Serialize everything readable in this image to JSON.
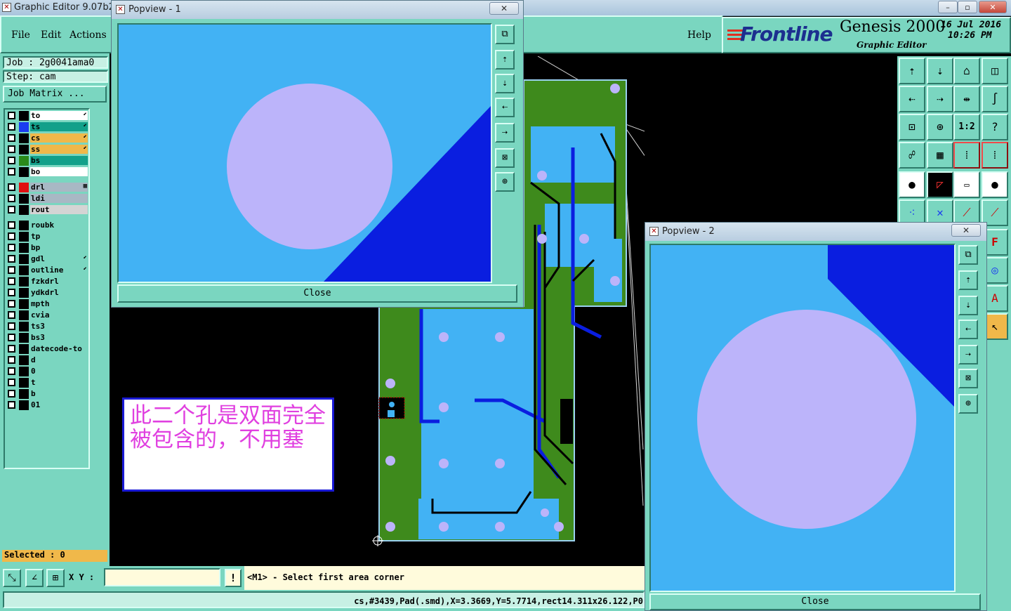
{
  "window": {
    "title": "Graphic Editor 9.07b2 (",
    "minimize_glyph": "–",
    "maximize_glyph": "▫",
    "close_glyph": "✕"
  },
  "menu": {
    "file": "File",
    "edit": "Edit",
    "actions": "Actions",
    "help": "Help"
  },
  "brand": {
    "logo": "Frontline",
    "product": "Genesis 2000",
    "subtitle": "Graphic Editor",
    "date": "16 Jul 2016",
    "time": "10:26 PM"
  },
  "job": {
    "job_label": "Job : 2g0041ama0",
    "step_label": "Step: cam",
    "matrix_button": "Job Matrix ..."
  },
  "layers": [
    {
      "name": "to",
      "swatch": "#000000",
      "bg": "#ffffff",
      "mark": "⬋"
    },
    {
      "name": "ts",
      "swatch": "#1a3cf0",
      "bg": "#13a08a",
      "mark": "⬋"
    },
    {
      "name": "cs",
      "swatch": "#000000",
      "bg": "#f0b84a",
      "mark": "⬋"
    },
    {
      "name": "ss",
      "swatch": "#000000",
      "bg": "#f0b84a",
      "mark": "⬋"
    },
    {
      "name": "bs",
      "swatch": "#2a8a1a",
      "bg": "#13a08a",
      "mark": ""
    },
    {
      "name": "bo",
      "swatch": "#000000",
      "bg": "#ffffff",
      "mark": ""
    },
    {
      "name": "drl",
      "swatch": "#e01010",
      "bg": "#a8b8c4",
      "mark": "▦"
    },
    {
      "name": "ldi",
      "swatch": "#000000",
      "bg": "#a8b8c4",
      "mark": ""
    },
    {
      "name": "rout",
      "swatch": "#000000",
      "bg": "#d4d4d4",
      "mark": ""
    },
    {
      "name": "roubk",
      "swatch": "#000000",
      "bg": "#7ad6c0",
      "mark": ""
    },
    {
      "name": "tp",
      "swatch": "#000000",
      "bg": "#7ad6c0",
      "mark": ""
    },
    {
      "name": "bp",
      "swatch": "#000000",
      "bg": "#7ad6c0",
      "mark": ""
    },
    {
      "name": "gdl",
      "swatch": "#000000",
      "bg": "#7ad6c0",
      "mark": "⬋"
    },
    {
      "name": "outline",
      "swatch": "#000000",
      "bg": "#7ad6c0",
      "mark": "⬋"
    },
    {
      "name": "fzkdrl",
      "swatch": "#000000",
      "bg": "#7ad6c0",
      "mark": ""
    },
    {
      "name": "ydkdrl",
      "swatch": "#000000",
      "bg": "#7ad6c0",
      "mark": ""
    },
    {
      "name": "mpth",
      "swatch": "#000000",
      "bg": "#7ad6c0",
      "mark": ""
    },
    {
      "name": "cvia",
      "swatch": "#000000",
      "bg": "#7ad6c0",
      "mark": ""
    },
    {
      "name": "ts3",
      "swatch": "#000000",
      "bg": "#7ad6c0",
      "mark": ""
    },
    {
      "name": "bs3",
      "swatch": "#000000",
      "bg": "#7ad6c0",
      "mark": ""
    },
    {
      "name": "datecode-to",
      "swatch": "#000000",
      "bg": "#7ad6c0",
      "mark": ""
    },
    {
      "name": "d",
      "swatch": "#000000",
      "bg": "#7ad6c0",
      "mark": ""
    },
    {
      "name": "0",
      "swatch": "#000000",
      "bg": "#7ad6c0",
      "mark": ""
    },
    {
      "name": "t",
      "swatch": "#000000",
      "bg": "#7ad6c0",
      "mark": ""
    },
    {
      "name": "b",
      "swatch": "#000000",
      "bg": "#7ad6c0",
      "mark": ""
    },
    {
      "name": "01",
      "swatch": "#000000",
      "bg": "#7ad6c0",
      "mark": ""
    }
  ],
  "selected": "Selected : 0",
  "xy": {
    "label": "X Y :",
    "value": ""
  },
  "prompt": "<M1> - Select first area corner",
  "status": "cs,#3439,Pad(.smd),X=3.3669,Y=5.7714,rect14.311x26.122,P0",
  "note": "此二个孔是双面完全被包含的，不用塞",
  "popview1": {
    "title": "Popview - 1",
    "close_label": "Close",
    "close_glyph": "✕"
  },
  "popview2": {
    "title": "Popview - 2",
    "close_label": "Close",
    "close_glyph": "✕"
  },
  "colors": {
    "panel": "#7ad6c0",
    "canvas": "#42b2f4",
    "pad": "#bcb4fa",
    "copper": "#0a1ee0",
    "board": "#3e8a1c"
  }
}
